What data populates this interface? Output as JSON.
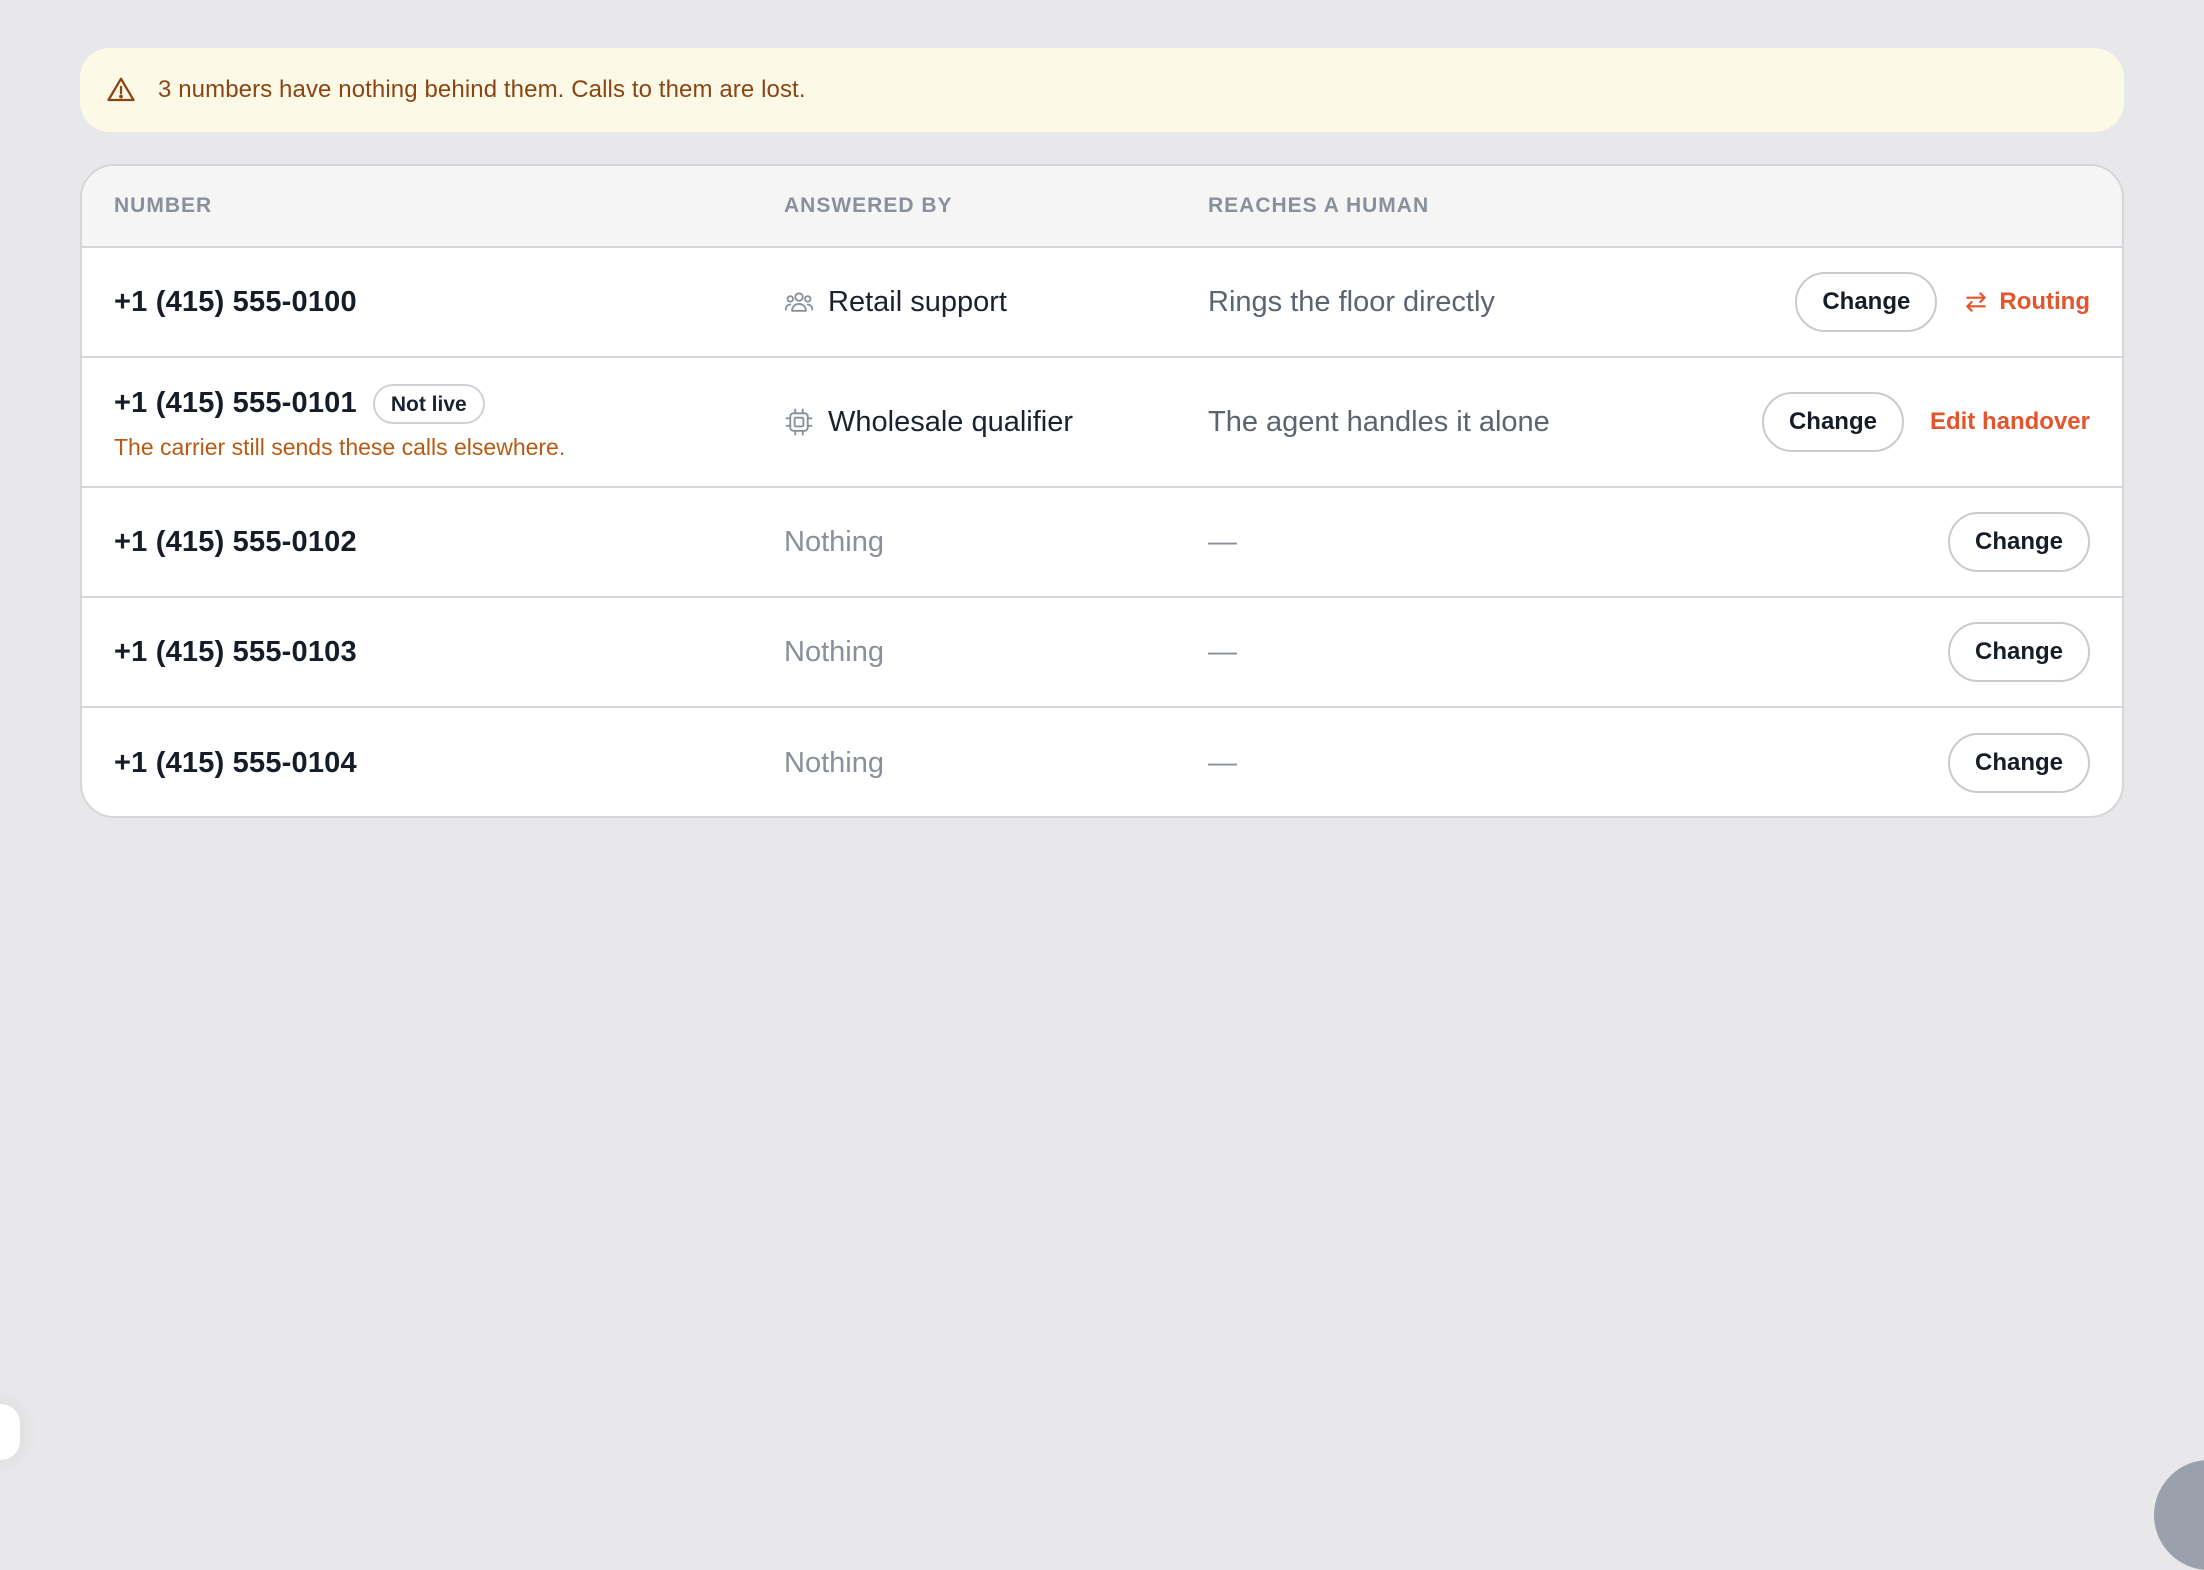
{
  "banner": {
    "icon": "warning-triangle-icon",
    "text": "3 numbers have nothing behind them. Calls to them are lost."
  },
  "table": {
    "headers": {
      "number": "NUMBER",
      "answered_by": "ANSWERED BY",
      "reaches_human": "REACHES A HUMAN"
    },
    "rows": [
      {
        "number": "+1 (415) 555-0100",
        "answered_by": "Retail support",
        "answered_icon": "team-icon",
        "reaches_human": "Rings the floor directly",
        "change_label": "Change",
        "secondary_action": "Routing",
        "secondary_icon": "swap-arrows-icon"
      },
      {
        "number": "+1 (415) 555-0101",
        "badge": "Not live",
        "warning": "The carrier still sends these calls elsewhere.",
        "answered_by": "Wholesale qualifier",
        "answered_icon": "chip-icon",
        "reaches_human": "The agent handles it alone",
        "change_label": "Change",
        "secondary_action": "Edit handover"
      },
      {
        "number": "+1 (415) 555-0102",
        "answered_by": "Nothing",
        "reaches_human": "—",
        "change_label": "Change"
      },
      {
        "number": "+1 (415) 555-0103",
        "answered_by": "Nothing",
        "reaches_human": "—",
        "change_label": "Change"
      },
      {
        "number": "+1 (415) 555-0104",
        "answered_by": "Nothing",
        "reaches_human": "—",
        "change_label": "Change"
      }
    ]
  },
  "colors": {
    "background": "#e8e8ea",
    "banner_bg": "#fdf9e7",
    "banner_text": "#8a4514",
    "accent": "#e5542a",
    "warning_text": "#b85a14"
  }
}
